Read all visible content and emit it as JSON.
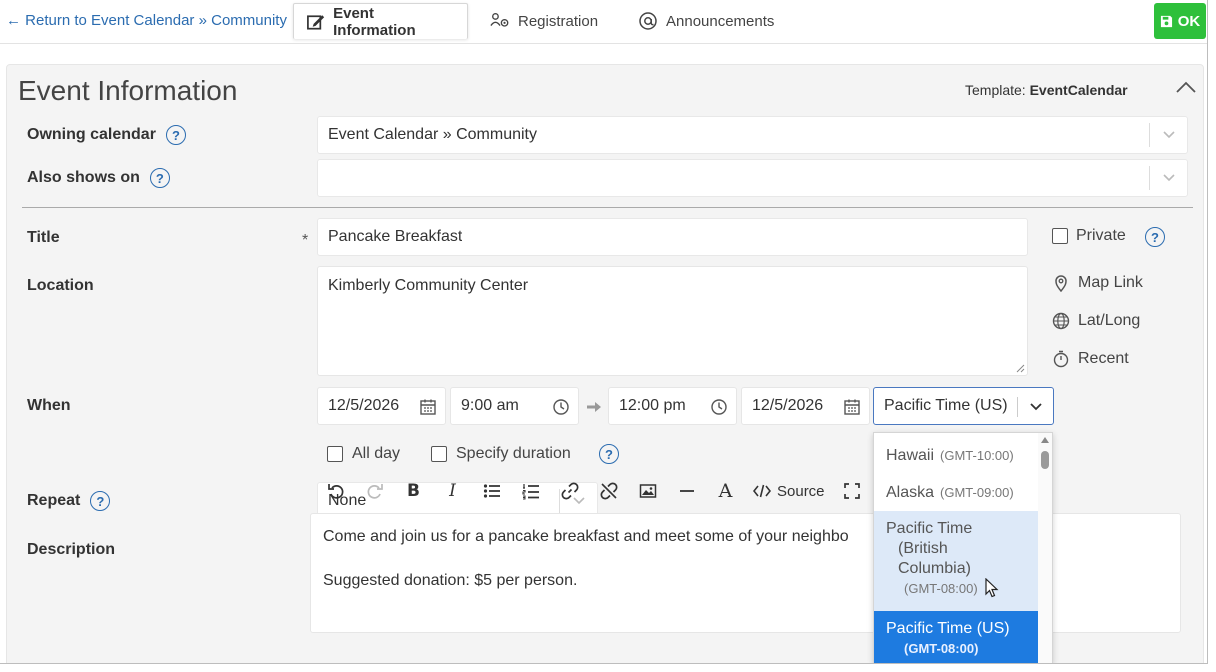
{
  "topbar": {
    "back_link": "← Return to Event Calendar » Community",
    "tabs": [
      {
        "label": "Event Information",
        "icon": "edit-icon"
      },
      {
        "label": "Registration",
        "icon": "people-gear-icon"
      },
      {
        "label": "Announcements",
        "icon": "at-sign-icon"
      }
    ],
    "ok_label": "OK"
  },
  "panel": {
    "title": "Event Information",
    "template_label": "Template:",
    "template_name": "EventCalendar"
  },
  "form": {
    "owning_calendar": {
      "label": "Owning calendar",
      "value": "Event Calendar » Community"
    },
    "also_shows_on": {
      "label": "Also shows on",
      "value": ""
    },
    "title": {
      "label": "Title",
      "required_mark": "*",
      "value": "Pancake Breakfast"
    },
    "private_label": "Private",
    "location": {
      "label": "Location",
      "value": "Kimberly Community Center"
    },
    "location_links": {
      "map": "Map Link",
      "latlong": "Lat/Long",
      "recent": "Recent"
    },
    "when": {
      "label": "When",
      "start_date": "12/5/2026",
      "start_time": "9:00 am",
      "end_time": "12:00 pm",
      "end_date": "12/5/2026",
      "timezone": "Pacific Time (US)",
      "all_day_label": "All day",
      "specify_duration_label": "Specify duration"
    },
    "repeat": {
      "label": "Repeat",
      "value": "None"
    },
    "description": {
      "label": "Description",
      "source_label": "Source",
      "lines": [
        "Come and join us for a pancake breakfast and meet some of your neighbo",
        "Suggested donation: $5 per person."
      ]
    }
  },
  "timezone_options": [
    {
      "name": "Hawaii",
      "offset": "(GMT-10:00)"
    },
    {
      "name": "Alaska",
      "offset": "(GMT-09:00)"
    },
    {
      "name_line1": "Pacific Time",
      "name_line2": "(British",
      "name_line3": "Columbia)",
      "offset": "(GMT-08:00)"
    },
    {
      "name": "Pacific Time (US)",
      "offset": "(GMT-08:00)"
    }
  ],
  "colors": {
    "accent": "#2b6cb0",
    "ok_green": "#2ec03b",
    "selected_blue": "#1e7be0"
  }
}
